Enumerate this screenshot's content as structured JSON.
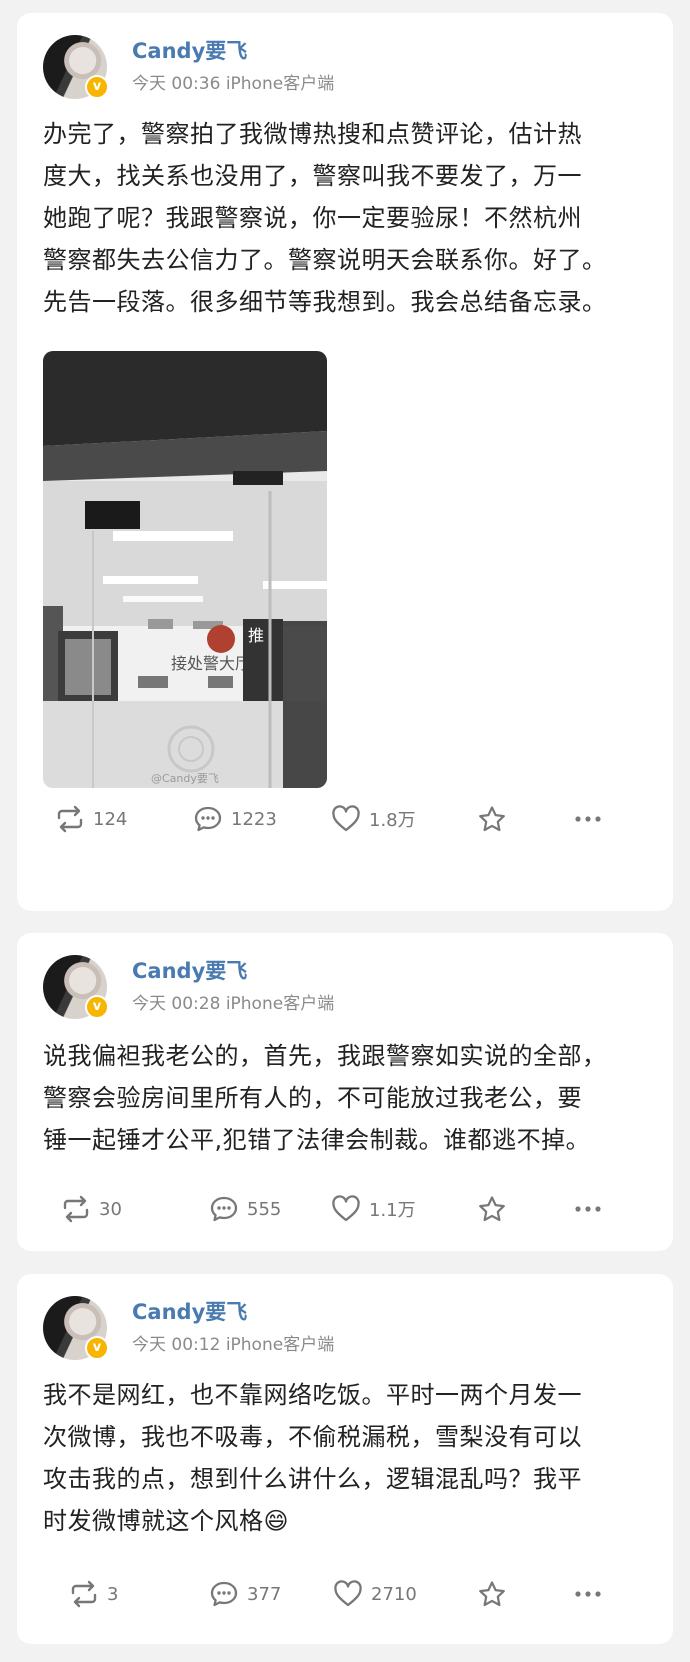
{
  "posts": [
    {
      "author": "Candy要飞",
      "time": "今天 00:36",
      "source": "iPhone客户端",
      "lines": [
        "办完了，警察拍了我微博热搜和点赞评论，估计热",
        "度大，找关系也没用了，警察叫我不要发了，万一",
        "她跑了呢？我跟警察说，你一定要验尿！不然杭州",
        "警察都失去公信力了。警察说明天会联系你。好了。",
        "先告一段落。很多细节等我想到。我会总结备忘录。"
      ],
      "image": {
        "sign_text": "接处警大厅",
        "sign_tag": "推",
        "watermark": "@Candy要飞"
      },
      "reposts": "124",
      "comments": "1223",
      "likes": "1.8万"
    },
    {
      "author": "Candy要飞",
      "time": "今天 00:28",
      "source": "iPhone客户端",
      "lines": [
        "说我偏袒我老公的，首先，我跟警察如实说的全部，",
        "警察会验房间里所有人的，不可能放过我老公，要",
        "锤一起锤才公平,犯错了法律会制裁。谁都逃不掉。"
      ],
      "reposts": "30",
      "comments": "555",
      "likes": "1.1万"
    },
    {
      "author": "Candy要飞",
      "time": "今天 00:12",
      "source": "iPhone客户端",
      "lines": [
        "我不是网红，也不靠网络吃饭。平时一两个月发一",
        "次微博，我也不吸毒，不偷税漏税，雪梨没有可以",
        "攻击我的点，想到什么讲什么，逻辑混乱吗？我平",
        "时发微博就这个风格😄"
      ],
      "reposts": "3",
      "comments": "377",
      "likes": "2710"
    }
  ],
  "icons": {
    "repost": "repost-icon",
    "comment": "comment-icon",
    "like": "heart-icon",
    "favorite": "star-icon",
    "more": "more-icon",
    "verified": "verified-badge-icon"
  },
  "colors": {
    "author_name": "#4a7bb0",
    "badge": "#f7b500",
    "action_icon": "#777777"
  }
}
